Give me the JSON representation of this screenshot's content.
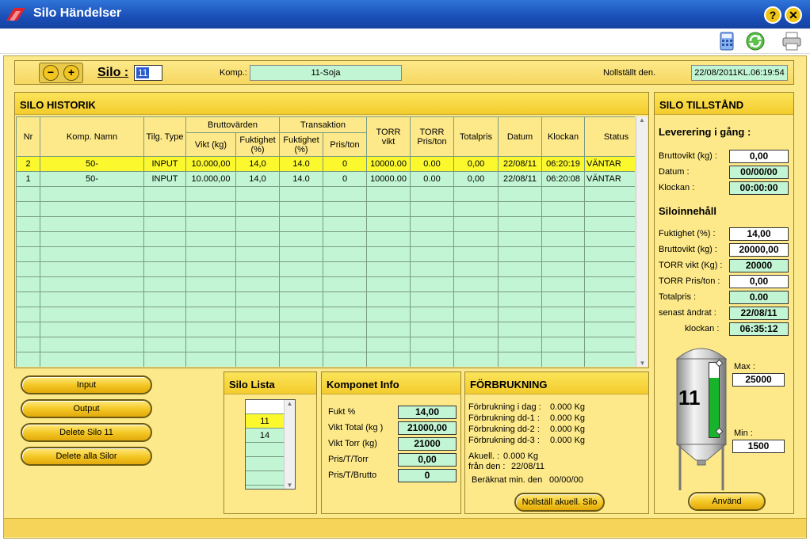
{
  "window": {
    "title": "Silo Händelser"
  },
  "header": {
    "silo_label": "Silo :",
    "silo_value": "11",
    "komp_label": "Komp.:",
    "komp_value": "11-Soja",
    "reset_label": "Nollställt den.",
    "reset_value": "22/08/2011KL.06:19:54"
  },
  "historik": {
    "title": "SILO HISTORIK",
    "group_brutto": "Bruttovärden",
    "group_trans": "Transaktion",
    "columns": [
      "Nr",
      "Komp. Namn",
      "Tilg. Type",
      "Vikt (kg)",
      "Fuktighet (%)",
      "Fuktighet (%)",
      "Pris/ton",
      "TORR vikt",
      "TORR Pris/ton",
      "Totalpris",
      "Datum",
      "Klockan",
      "Status"
    ],
    "rows": [
      [
        "2",
        "50-",
        "INPUT",
        "10.000,00",
        "14,0",
        "14.0",
        "0",
        "10000.00",
        "0.00",
        "0,00",
        "22/08/11",
        "06:20:19",
        "VÄNTAR"
      ],
      [
        "1",
        "50-",
        "INPUT",
        "10.000,00",
        "14,0",
        "14.0",
        "0",
        "10000.00",
        "0.00",
        "0,00",
        "22/08/11",
        "06:20:08",
        "VÄNTAR"
      ]
    ],
    "empty_rows": 12
  },
  "actions": {
    "input": "Input",
    "output": "Output",
    "delete_silo": "Delete Silo 11",
    "delete_all": "Delete alla Silor"
  },
  "silo_lista": {
    "title": "Silo Lista",
    "items": [
      "",
      "11",
      "14",
      "",
      "",
      ""
    ]
  },
  "komponent_info": {
    "title": "Komponet Info",
    "rows": [
      {
        "label": "Fukt %",
        "value": "14,00"
      },
      {
        "label": "Vikt Total (kg )",
        "value": "21000,00"
      },
      {
        "label": "Vikt Torr (kg)",
        "value": "21000"
      },
      {
        "label": "Pris/T/Torr",
        "value": "0,00"
      },
      {
        "label": "Pris/T/Brutto",
        "value": "0"
      }
    ]
  },
  "forbrukning": {
    "title": "FÖRBRUKNING",
    "rows": [
      {
        "label": "Förbrukning i dag :",
        "value": "0.000 Kg"
      },
      {
        "label": "Förbrukning dd-1 :",
        "value": "0.000 Kg"
      },
      {
        "label": "Förbrukning dd-2 :",
        "value": "0.000 Kg"
      },
      {
        "label": "Förbrukning dd-3 :",
        "value": "0.000 Kg"
      }
    ],
    "akuell_label": "Akuell. :",
    "akuell_value": "0.000 Kg",
    "fran_label": "från den :",
    "fran_value": "22/08/11",
    "beraknat_label": "Beräknat min. den",
    "beraknat_value": "00/00/00",
    "reset_button": "Nollställ akuell. Silo"
  },
  "tillstand": {
    "title": "SILO TILLSTÅND",
    "levering_heading": "Leverering i gång :",
    "levering": [
      {
        "label": "Bruttovikt (kg) :",
        "value": "0,00",
        "green": false
      },
      {
        "label": "Datum :",
        "value": "00/00/00",
        "green": true
      },
      {
        "label": "Klockan :",
        "value": "00:00:00",
        "green": true
      }
    ],
    "innehall_heading": "Siloinnehåll",
    "innehall": [
      {
        "label": "Fuktighet (%) :",
        "value": "14,00",
        "green": false
      },
      {
        "label": "Bruttovikt (kg) :",
        "value": "20000,00",
        "green": false
      },
      {
        "label": "TORR vikt (Kg) :",
        "value": "20000",
        "green": true
      },
      {
        "label": "TORR Pris/ton :",
        "value": "0,00",
        "green": false
      },
      {
        "label": "Totalpris :",
        "value": "0.00",
        "green": true
      },
      {
        "label": "senast ändrat :",
        "value": "22/08/11",
        "green": true
      },
      {
        "label": "klockan :",
        "value": "06:35:12",
        "green": true
      }
    ],
    "silo_number": "11",
    "fill_fraction": 0.8,
    "max_label": "Max :",
    "max_value": "25000",
    "min_label": "Min :",
    "min_value": "1500",
    "apply_button": "Använd"
  },
  "colors": {
    "titlebar": "#1a4fb8",
    "panel": "#fde98a",
    "row_green": "#c2f5d3",
    "row_selected": "#fbf82e",
    "button": "#f3c521"
  }
}
